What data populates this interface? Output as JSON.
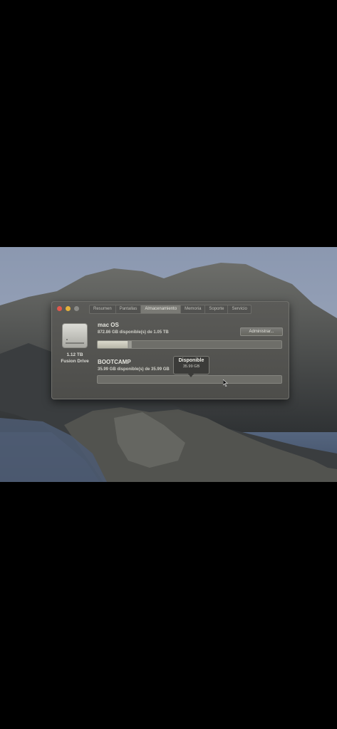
{
  "window": {
    "tabs": [
      {
        "label": "Resumen",
        "active": false
      },
      {
        "label": "Pantallas",
        "active": false
      },
      {
        "label": "Almacenamiento",
        "active": true
      },
      {
        "label": "Memoria",
        "active": false
      },
      {
        "label": "Soporte",
        "active": false
      },
      {
        "label": "Servicio",
        "active": false
      }
    ],
    "drive": {
      "capacity": "1.12 TB",
      "name": "Fusion Drive"
    },
    "volumes": [
      {
        "name": "mac OS",
        "detail": "872.86 GB disponible(s) de 1.05 TB",
        "used_fraction": 0.17,
        "manage_label": "Administrar..."
      },
      {
        "name": "BOOTCAMP",
        "detail": "35.99 GB disponible(s) de 35.99 GB",
        "used_fraction": 0.0
      }
    ],
    "tooltip": {
      "title": "Disponible",
      "value": "35.99 GB"
    }
  },
  "colors": {
    "traffic_red": "#e0574c",
    "traffic_yellow": "#e4b13b",
    "window_bg": "#4d4d4a"
  }
}
